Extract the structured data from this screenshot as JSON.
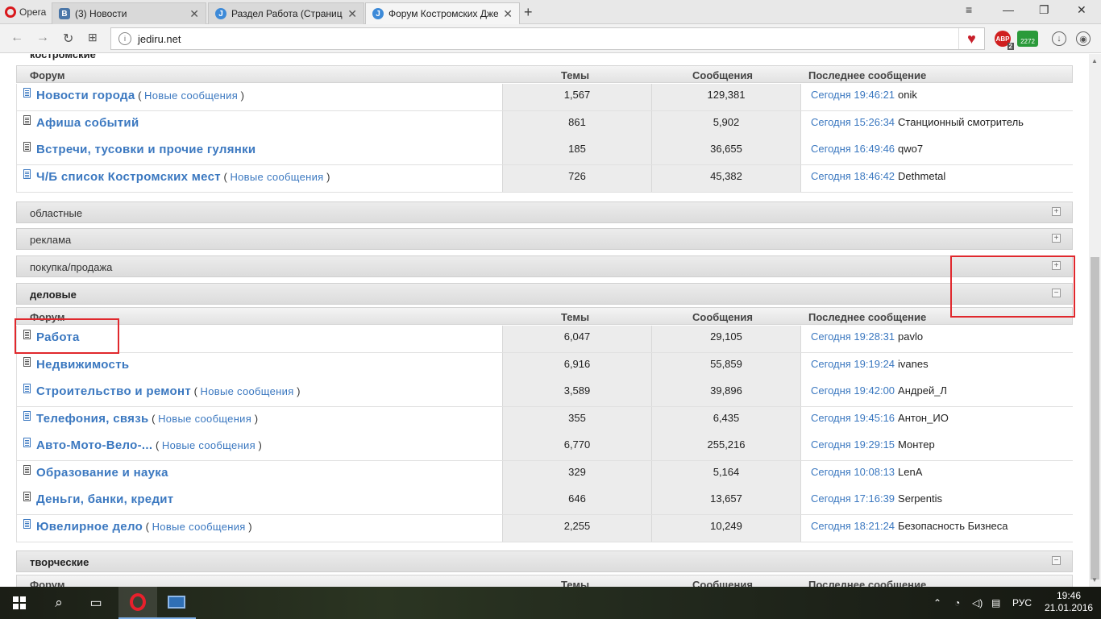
{
  "browser": {
    "menu_label": "Opera",
    "tabs": [
      {
        "title": "(3) Новости",
        "icon": "vk-icon"
      },
      {
        "title": "Раздел Работа (Страница",
        "icon": "jediru-icon"
      },
      {
        "title": "Форум Костромских Дже",
        "icon": "jediru-icon"
      }
    ],
    "new_tab": "+",
    "window_controls": {
      "minimize": "—",
      "restore": "❐",
      "close": "✕"
    },
    "url": "jediru.net",
    "ext_abp": "ABP",
    "ext_abp_badge": "2",
    "ext_counter": "2272"
  },
  "page": {
    "cut_category": "костромские",
    "headers": {
      "forum": "Форум",
      "topics": "Темы",
      "posts": "Сообщения",
      "last": "Последнее сообщение"
    },
    "new_messages_label": "Новые сообщения",
    "kostroma_forums": [
      {
        "name": "Новости города",
        "new": true,
        "topics": "1,567",
        "posts": "129,381",
        "last_time": "Сегодня 19:46:21",
        "last_user": "onik"
      },
      {
        "name": "Афиша событий",
        "new": false,
        "topics": "861",
        "posts": "5,902",
        "last_time": "Сегодня 15:26:34",
        "last_user": "Станционный смотритель"
      },
      {
        "name": "Встречи, тусовки и прочие гулянки",
        "new": false,
        "topics": "185",
        "posts": "36,655",
        "last_time": "Сегодня 16:49:46",
        "last_user": "qwo7"
      },
      {
        "name": "Ч/Б список Костромских мест",
        "new": true,
        "topics": "726",
        "posts": "45,382",
        "last_time": "Сегодня 18:46:42",
        "last_user": "Dethmetal"
      }
    ],
    "collapsed_categories": [
      "областные",
      "реклама",
      "покупка/продажа"
    ],
    "business_category": "деловые",
    "business_forums": [
      {
        "name": "Работа",
        "new": false,
        "topics": "6,047",
        "posts": "29,105",
        "last_time": "Сегодня 19:28:31",
        "last_user": "pavlo"
      },
      {
        "name": "Недвижимость",
        "new": false,
        "topics": "6,916",
        "posts": "55,859",
        "last_time": "Сегодня 19:19:24",
        "last_user": "ivanes"
      },
      {
        "name": "Строительство и ремонт",
        "new": true,
        "topics": "3,589",
        "posts": "39,896",
        "last_time": "Сегодня 19:42:00",
        "last_user": "Андрей_Л"
      },
      {
        "name": "Телефония, связь",
        "new": true,
        "topics": "355",
        "posts": "6,435",
        "last_time": "Сегодня 19:45:16",
        "last_user": "Антон_ИО"
      },
      {
        "name": "Авто-Мото-Вело-...",
        "new": true,
        "topics": "6,770",
        "posts": "255,216",
        "last_time": "Сегодня 19:29:15",
        "last_user": "Монтер"
      },
      {
        "name": "Образование и наука",
        "new": false,
        "topics": "329",
        "posts": "5,164",
        "last_time": "Сегодня 10:08:13",
        "last_user": "LenA"
      },
      {
        "name": "Деньги, банки, кредит",
        "new": false,
        "topics": "646",
        "posts": "13,657",
        "last_time": "Сегодня 17:16:39",
        "last_user": "Serpentis"
      },
      {
        "name": "Ювелирное дело",
        "new": true,
        "topics": "2,255",
        "posts": "10,249",
        "last_time": "Сегодня 18:21:24",
        "last_user": "Безопасность Бизнеса"
      }
    ],
    "creative_category": "творческие"
  },
  "taskbar": {
    "lang": "РУС",
    "time": "19:46",
    "date": "21.01.2016"
  }
}
